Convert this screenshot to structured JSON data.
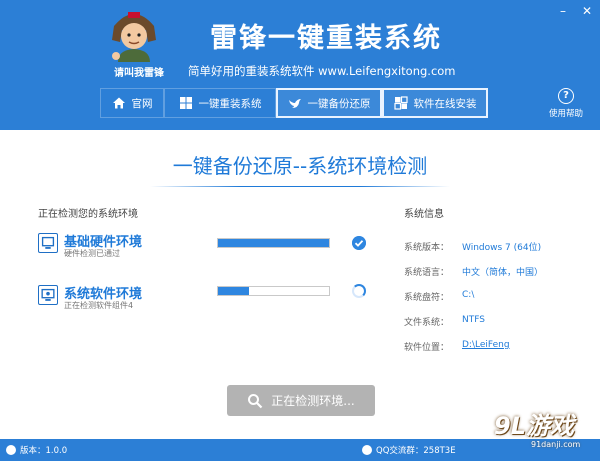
{
  "window": {
    "minimize": "–",
    "close": "✕"
  },
  "header": {
    "avatar_caption": "请叫我雷锋",
    "title": "雷锋一键重装系统",
    "subtitle": "简单好用的重装系统软件 www.Leifengxitong.com"
  },
  "nav": {
    "items": [
      {
        "label": "官网",
        "icon": "home-icon"
      },
      {
        "label": "一键重装系统",
        "icon": "windows-icon"
      },
      {
        "label": "一键备份还原",
        "icon": "bird-icon",
        "active": true
      },
      {
        "label": "软件在线安装",
        "icon": "grid-icon"
      }
    ]
  },
  "help": {
    "label": "使用帮助"
  },
  "main": {
    "title": "一键备份还原--系统环境检测",
    "left_heading": "正在检测您的系统环境",
    "checks": [
      {
        "title": "基础硬件环境",
        "subtitle": "硬件检测已通过",
        "progress": 1.0,
        "status": "done"
      },
      {
        "title": "系统软件环境",
        "subtitle": "正在检测软件组件4",
        "progress": 0.28,
        "status": "running"
      }
    ],
    "sys_heading": "系统信息",
    "sys_info": [
      {
        "label": "系统版本：",
        "value": "Windows 7 (64位)"
      },
      {
        "label": "系统语言：",
        "value": "中文（简体，中国）"
      },
      {
        "label": "系统盘符：",
        "value": "C:\\"
      },
      {
        "label": "文件系统：",
        "value": "NTFS"
      },
      {
        "label": "软件位置：",
        "value": "D:\\LeiFeng",
        "link": true
      }
    ],
    "detect_button": "正在检测环境..."
  },
  "footer": {
    "version": "版本：1.0.0",
    "qq": "QQ交流群：258T3E"
  },
  "watermark": {
    "text": "9L游戏",
    "sub": "91danji.com"
  },
  "colors": {
    "brand": "#2c7fd6",
    "accent": "#1f7ad8",
    "button_disabled": "#b3b3b3"
  }
}
